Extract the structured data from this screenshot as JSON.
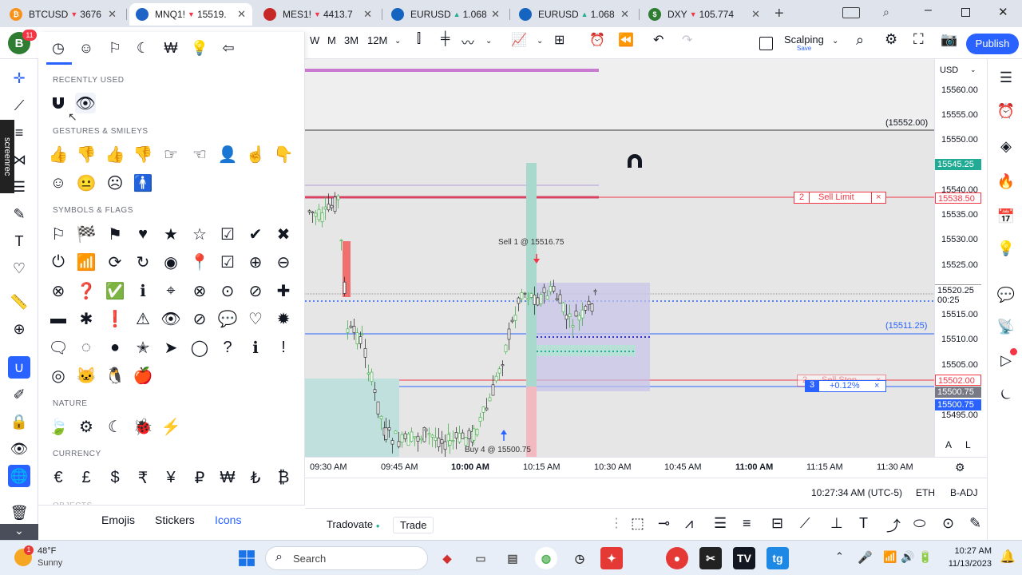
{
  "browser_tabs": [
    {
      "label": "BTCUSD",
      "arrow": "▼",
      "price": "3676",
      "fav": "₿",
      "fav_color": "#f7931a",
      "active": false
    },
    {
      "label": "MNQ1!",
      "arrow": "▼",
      "price": "15519.",
      "fav": "",
      "fav_color": "#1e63c6",
      "active": true
    },
    {
      "label": "MES1!",
      "arrow": "▼",
      "price": "4413.7",
      "fav": "",
      "fav_color": "#c62828",
      "active": false
    },
    {
      "label": "EURUSD",
      "arrow": "▲",
      "price": "1.068",
      "fav": "",
      "fav_color": "#1565c0",
      "active": false
    },
    {
      "label": "EURUSD",
      "arrow": "▲",
      "price": "1.068",
      "fav": "",
      "fav_color": "#1565c0",
      "active": false
    },
    {
      "label": "DXY",
      "arrow": "▼",
      "price": "105.774",
      "fav": "$",
      "fav_color": "#2e7d32",
      "active": false
    }
  ],
  "header": {
    "avatar_letter": "B",
    "avatar_badge": "11",
    "intervals": [
      "W",
      "M",
      "3M",
      "12M"
    ],
    "layout_name": "Scalping",
    "layout_sub": "Save",
    "publish": "Publish"
  },
  "picker": {
    "sections": {
      "recent": "RECENTLY USED",
      "gestures": "GESTURES & SMILEYS",
      "symbols": "SYMBOLS & FLAGS",
      "nature": "NATURE",
      "currency": "CURRENCY",
      "objects": "OBJECTS"
    },
    "currency_symbols": [
      "€",
      "£",
      "$",
      "₹",
      "¥",
      "₽",
      "₩",
      "₺",
      "₿"
    ],
    "tabs": [
      "Emojis",
      "Stickers",
      "Icons"
    ],
    "active_tab": "Icons"
  },
  "chart": {
    "price_ticks": [
      "15560.00",
      "15555.00",
      "15550.00",
      "15540.00",
      "15535.00",
      "15530.00",
      "15525.00",
      "15515.00",
      "15510.00",
      "15505.00",
      "15495.00"
    ],
    "currency": "USD",
    "price_labels": [
      {
        "text": "15545.25",
        "color": "#22ab94"
      },
      {
        "text": "15538.50",
        "color": "#f23645"
      },
      {
        "text": "15520.25",
        "color": "#ffffff"
      },
      {
        "text": "00:25",
        "color": "#ffffff"
      },
      {
        "text": "15502.00",
        "color": "#f23645"
      },
      {
        "text": "15500.75",
        "color": "#787b86"
      },
      {
        "text": "15500.75",
        "color": "#2962ff"
      }
    ],
    "level_labels": [
      "(15552.00)",
      "(15511.25)"
    ],
    "sell_limit": {
      "qty": "2",
      "label": "Sell Limit",
      "close": "×"
    },
    "sell_stop": {
      "qty": "2",
      "label": "Sell Stop",
      "close": "×"
    },
    "position": {
      "qty": "3",
      "pnl": "+0.12%",
      "close": "×"
    },
    "sell_annotation": "Sell 1 @ 15516.75",
    "buy_annotation": "Buy 4 @ 15500.75",
    "time_ticks": [
      "09:30 AM",
      "09:45 AM",
      "10:00 AM",
      "10:15 AM",
      "10:30 AM",
      "10:45 AM",
      "11:00 AM",
      "11:15 AM",
      "11:30 AM"
    ],
    "scale_buttons": [
      "A",
      "L"
    ]
  },
  "status": {
    "clock": "10:27:34 AM (UTC-5)",
    "session": "ETH",
    "adj": "B-ADJ"
  },
  "broker": {
    "name": "Tradovate",
    "trade": "Trade"
  },
  "taskbar": {
    "temp": "48°F",
    "weather": "Sunny",
    "weather_badge": "1",
    "search": "Search",
    "time": "10:27 AM",
    "date": "11/13/2023"
  },
  "overlay": {
    "brand": "screenrec"
  },
  "colors": {
    "accent": "#2962ff",
    "up": "#22ab94",
    "down": "#f23645"
  }
}
